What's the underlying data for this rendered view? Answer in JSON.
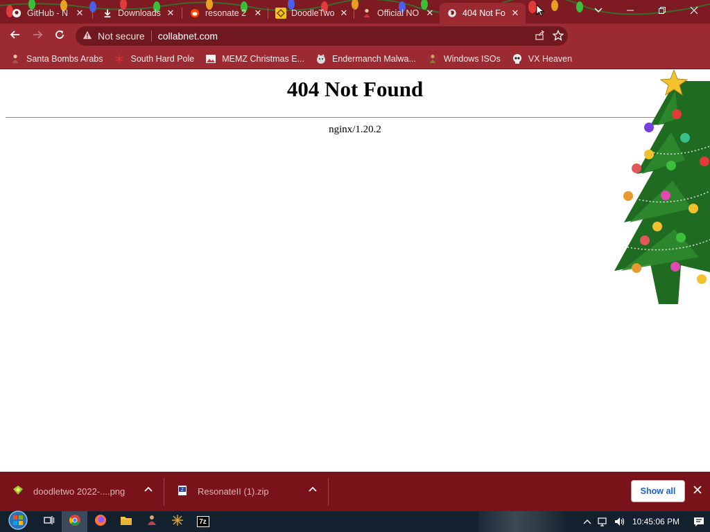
{
  "browser": {
    "tabs": [
      {
        "title": "GitHub - N",
        "icon": "github-icon"
      },
      {
        "title": "Downloads",
        "icon": "download-icon"
      },
      {
        "title": "resonate 2",
        "icon": "reddit-icon"
      },
      {
        "title": "DoodleTwo",
        "icon": "doodletwo-icon"
      },
      {
        "title": "Official NO",
        "icon": "figure-icon"
      },
      {
        "title": "404 Not Fo",
        "icon": "globe-icon",
        "active": true
      }
    ],
    "close_glyph": "✕"
  },
  "toolbar": {
    "security_label": "Not secure",
    "url": "collabnet.com"
  },
  "bookmarks": [
    {
      "label": "Santa Bombs Arabs",
      "icon": "figure-icon"
    },
    {
      "label": "South Hard Pole",
      "icon": "snowflake-icon"
    },
    {
      "label": "MEMZ Christmas E...",
      "icon": "image-icon"
    },
    {
      "label": "Endermanch Malwa...",
      "icon": "wolf-icon"
    },
    {
      "label": "Windows ISOs",
      "icon": "figure-icon"
    },
    {
      "label": "VX Heaven",
      "icon": "skull-icon"
    }
  ],
  "page": {
    "heading": "404 Not Found",
    "server": "nginx/1.20.2"
  },
  "downloads": {
    "items": [
      {
        "name": "doodletwo 2022-....png",
        "icon": "image-file-icon"
      },
      {
        "name": "ResonateII (1).zip",
        "icon": "zip-file-icon"
      }
    ],
    "show_all_label": "Show all"
  },
  "taskbar": {
    "clock": "10:45:06 PM",
    "apps": [
      "start-button",
      "task-view-icon",
      "chrome-icon",
      "firefox-icon",
      "file-explorer-icon",
      "app-icon",
      "app-icon",
      "7zip-icon"
    ],
    "sevenzip_label": "7z"
  },
  "colors": {
    "tabstrip": "#7d1a22",
    "toolbar": "#9c2a32",
    "downloads": "#7a1219",
    "taskbar": "#13202e",
    "show_all_text": "#1a5fd0"
  }
}
